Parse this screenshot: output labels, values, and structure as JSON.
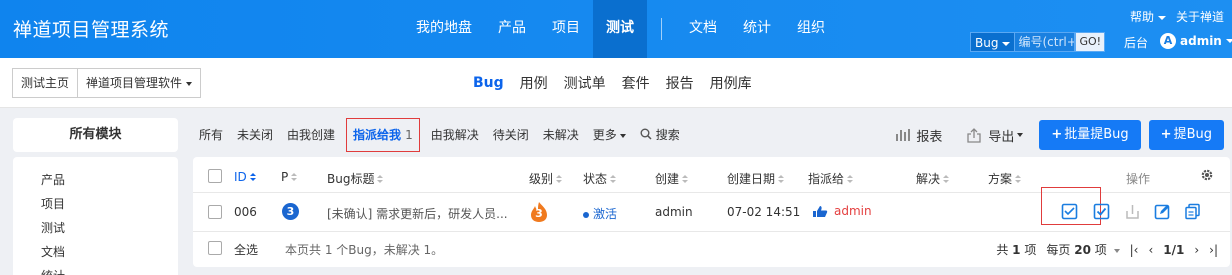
{
  "app": {
    "title": "禅道项目管理系统"
  },
  "mainnav": [
    "我的地盘",
    "产品",
    "项目",
    "测试",
    "文档",
    "统计",
    "组织"
  ],
  "header_right": {
    "help": "帮助",
    "about": "关于禅道",
    "search_type": "Bug",
    "search_placeholder": "编号(ctrl+g",
    "search_go": "GO!",
    "backend": "后台",
    "avatar_letter": "A",
    "user": "admin"
  },
  "breadcrumb": {
    "home": "测试主页",
    "product": "禅道项目管理软件"
  },
  "subnav": [
    "Bug",
    "用例",
    "测试单",
    "套件",
    "报告",
    "用例库"
  ],
  "featurebar": {
    "module_btn": "所有模块",
    "filters": [
      "所有",
      "未关闭",
      "由我创建",
      "指派给我",
      "由我解决",
      "待关闭",
      "未解决",
      "更多",
      "搜索"
    ],
    "active_count": "1",
    "report": "报表",
    "export": "导出",
    "batch_create": "批量提Bug",
    "create": "提Bug"
  },
  "sidebar": {
    "items": [
      "产品",
      "项目",
      "测试",
      "文档",
      "统计"
    ]
  },
  "table": {
    "headers": {
      "id": "ID",
      "pri": "P",
      "title": "Bug标题",
      "severity": "级别",
      "status": "状态",
      "creator": "创建",
      "date": "创建日期",
      "assigned": "指派给",
      "resolved": "解决",
      "solution": "方案",
      "actions": "操作"
    },
    "rows": [
      {
        "id": "006",
        "pri": "3",
        "title": "[未确认] 需求更新后，研发人员...",
        "severity": "3",
        "status": "激活",
        "creator": "admin",
        "date": "07-02 14:51",
        "assigned": "admin"
      }
    ],
    "footer": {
      "select_all": "全选",
      "summary": "本页共 1 个Bug，未解决 1。"
    },
    "pager": {
      "total_label": "共",
      "total": "1",
      "total_unit": "项",
      "per_page_label": "每页",
      "per_page": "20",
      "per_page_unit": "项",
      "page": "1/1"
    }
  },
  "colors": {
    "header": "#1a89f0",
    "accent": "#157af6",
    "highlight": "#e03c3c",
    "status_dot": "#1a66d0"
  }
}
